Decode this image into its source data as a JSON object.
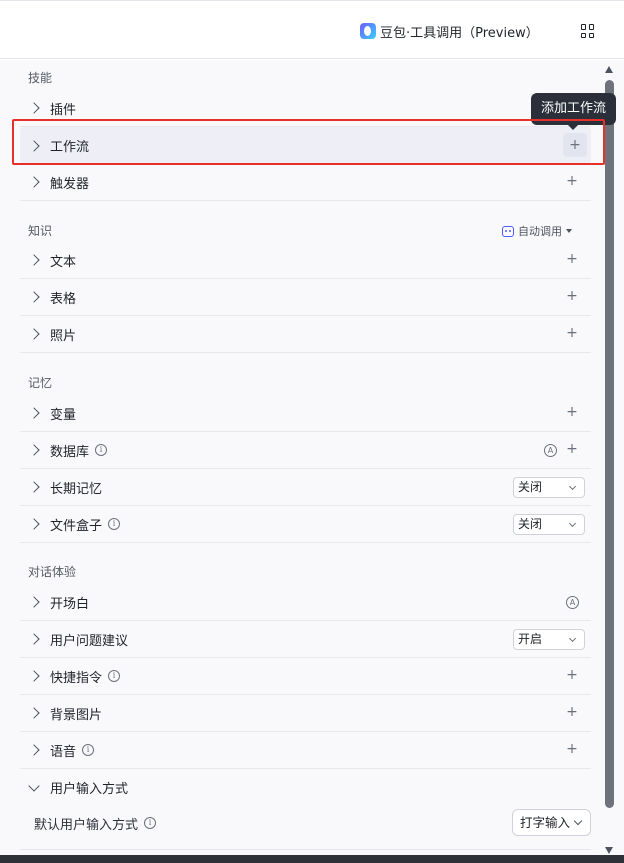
{
  "header": {
    "model_name": "豆包·工具调用（Preview）"
  },
  "tooltip": {
    "text": "添加工作流"
  },
  "skills": {
    "title": "技能",
    "items": [
      {
        "label": "插件"
      },
      {
        "label": "工作流"
      },
      {
        "label": "触发器"
      }
    ]
  },
  "knowledge": {
    "title": "知识",
    "auto_call": "自动调用",
    "items": [
      {
        "label": "文本"
      },
      {
        "label": "表格"
      },
      {
        "label": "照片"
      }
    ]
  },
  "memory": {
    "title": "记忆",
    "items": [
      {
        "label": "变量"
      },
      {
        "label": "数据库"
      },
      {
        "label": "长期记忆",
        "value": "关闭"
      },
      {
        "label": "文件盒子",
        "value": "关闭"
      }
    ]
  },
  "conversation": {
    "title": "对话体验",
    "items": [
      {
        "label": "开场白"
      },
      {
        "label": "用户问题建议",
        "value": "开启"
      },
      {
        "label": "快捷指令"
      },
      {
        "label": "背景图片"
      },
      {
        "label": "语音"
      },
      {
        "label": "用户输入方式"
      }
    ],
    "input_method": {
      "label": "默认用户输入方式",
      "value": "打字输入"
    }
  },
  "colors": {
    "highlight": "#e8302a",
    "tooltip_bg": "#2a2f3a",
    "accent": "#4c5cff"
  }
}
